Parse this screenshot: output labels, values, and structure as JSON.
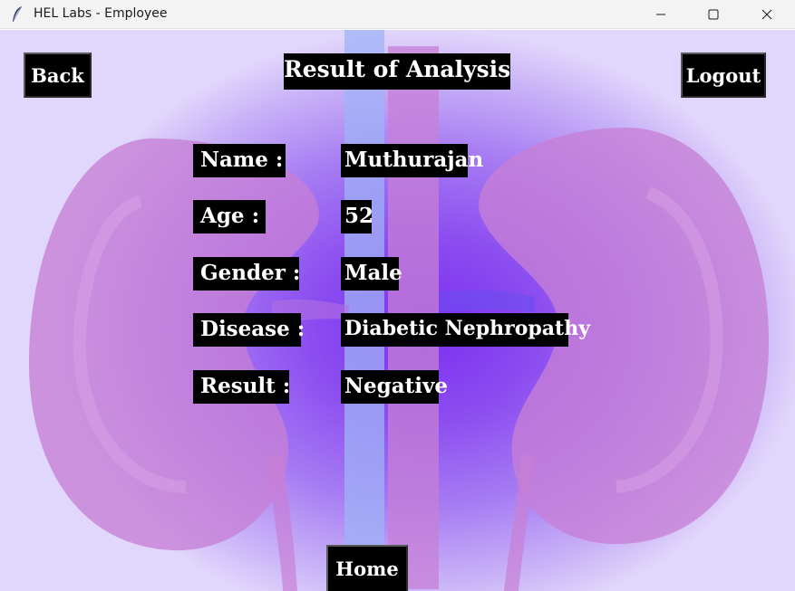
{
  "window": {
    "title": "HEL Labs - Employee"
  },
  "header": {
    "back_label": "Back",
    "title": "Result of Analysis",
    "logout_label": "Logout"
  },
  "fields": {
    "name": {
      "label": "Name :",
      "value": "Muthurajan"
    },
    "age": {
      "label": "Age :",
      "value": "52"
    },
    "gender": {
      "label": "Gender :",
      "value": "Male"
    },
    "disease": {
      "label": "Disease :",
      "value": "Diabetic Nephropathy"
    },
    "result": {
      "label": "Result :",
      "value": "Negative"
    }
  },
  "footer": {
    "home_label": "Home"
  },
  "icons": {
    "app": "feather-icon",
    "minimize": "minimize-icon",
    "maximize": "maximize-icon",
    "close": "close-icon"
  },
  "colors": {
    "label_bg": "#000000",
    "label_text": "#ffffff",
    "bg_accent": "#7b2ff0",
    "organ": "#c77fd6"
  }
}
